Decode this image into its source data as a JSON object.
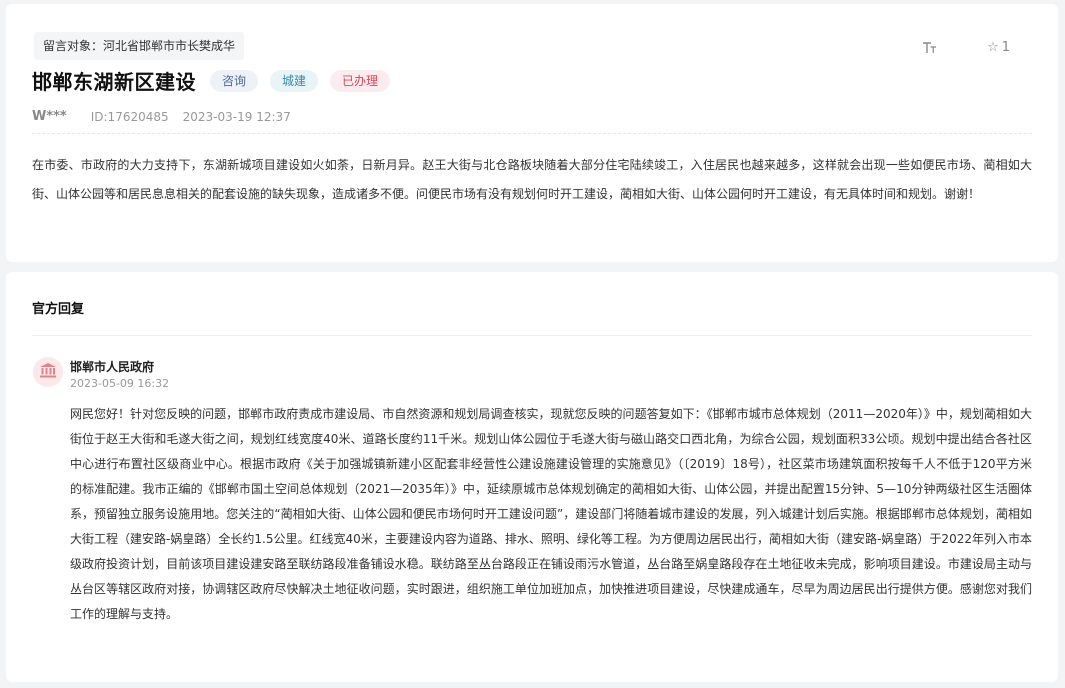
{
  "message": {
    "recipient": "留言对象：河北省邯郸市市长樊成华",
    "title": "邯郸东湖新区建设",
    "tags": [
      "咨询",
      "城建",
      "已办理"
    ],
    "author": "W***",
    "id": "ID:17620485",
    "datetime": "2023-03-19 12:37",
    "favorite_count": "1",
    "content": "在市委、市政府的大力支持下，东湖新城项目建设如火如荼，日新月异。赵王大街与北仓路板块随着大部分住宅陆续竣工，入住居民也越来越多，这样就会出现一些如便民市场、蔺相如大街、山体公园等和居民息息相关的配套设施的缺失现象，造成诸多不便。问便民市场有没有规划何时开工建设，蔺相如大街、山体公园何时开工建设，有无具体时间和规划。谢谢！"
  },
  "reply": {
    "heading": "官方回复",
    "org": "邯郸市人民政府",
    "date": "2023-05-09 16:32",
    "content": "网民您好！针对您反映的问题，邯郸市政府责成市建设局、市自然资源和规划局调查核实，现就您反映的问题答复如下：《邯郸市城市总体规划（2011—2020年）》中，规划蔺相如大街位于赵王大街和毛遂大街之间，规划红线宽度40米、道路长度约11千米。规划山体公园位于毛遂大街与磁山路交口西北角，为综合公园，规划面积33公顷。规划中提出结合各社区中心进行布置社区级商业中心。根据市政府《关于加强城镇新建小区配套非经营性公建设施建设管理的实施意见》（〔2019〕18号），社区菜市场建筑面积按每千人不低于120平方米的标准配建。我市正编的《邯郸市国土空间总体规划（2021—2035年）》中，延续原城市总体规划确定的蔺相如大街、山体公园，并提出配置15分钟、5—10分钟两级社区生活圈体系，预留独立服务设施用地。您关注的“蔺相如大街、山体公园和便民市场何时开工建设问题”，建设部门将随着城市建设的发展，列入城建计划后实施。根据邯郸市总体规划，蔺相如大街工程（建安路-娲皇路）全长约1.5公里。红线宽40米，主要建设内容为道路、排水、照明、绿化等工程。为方便周边居民出行，蔺相如大街（建安路-娲皇路）于2022年列入市本级政府投资计划，目前该项目建设建安路至联纺路段准备铺设水稳。联纺路至丛台路段正在铺设雨污水管道，丛台路至娲皇路段存在土地征收未完成，影响项目建设。市建设局主动与丛台区等辖区政府对接，协调辖区政府尽快解决土地征收问题，实时跟进，组织施工单位加班加点，加快推进项目建设，尽快建成通车，尽早为周边居民出行提供方便。感谢您对我们工作的理解与支持。"
  },
  "icons": {
    "font_size": "font-size-icon",
    "favorite": "star-icon",
    "government": "government-building-icon"
  },
  "colors": {
    "tag_consult": "#4a6a9a",
    "tag_city": "#3a8ab0",
    "tag_done": "#d64a5a",
    "gov_icon": "#e0848c"
  }
}
